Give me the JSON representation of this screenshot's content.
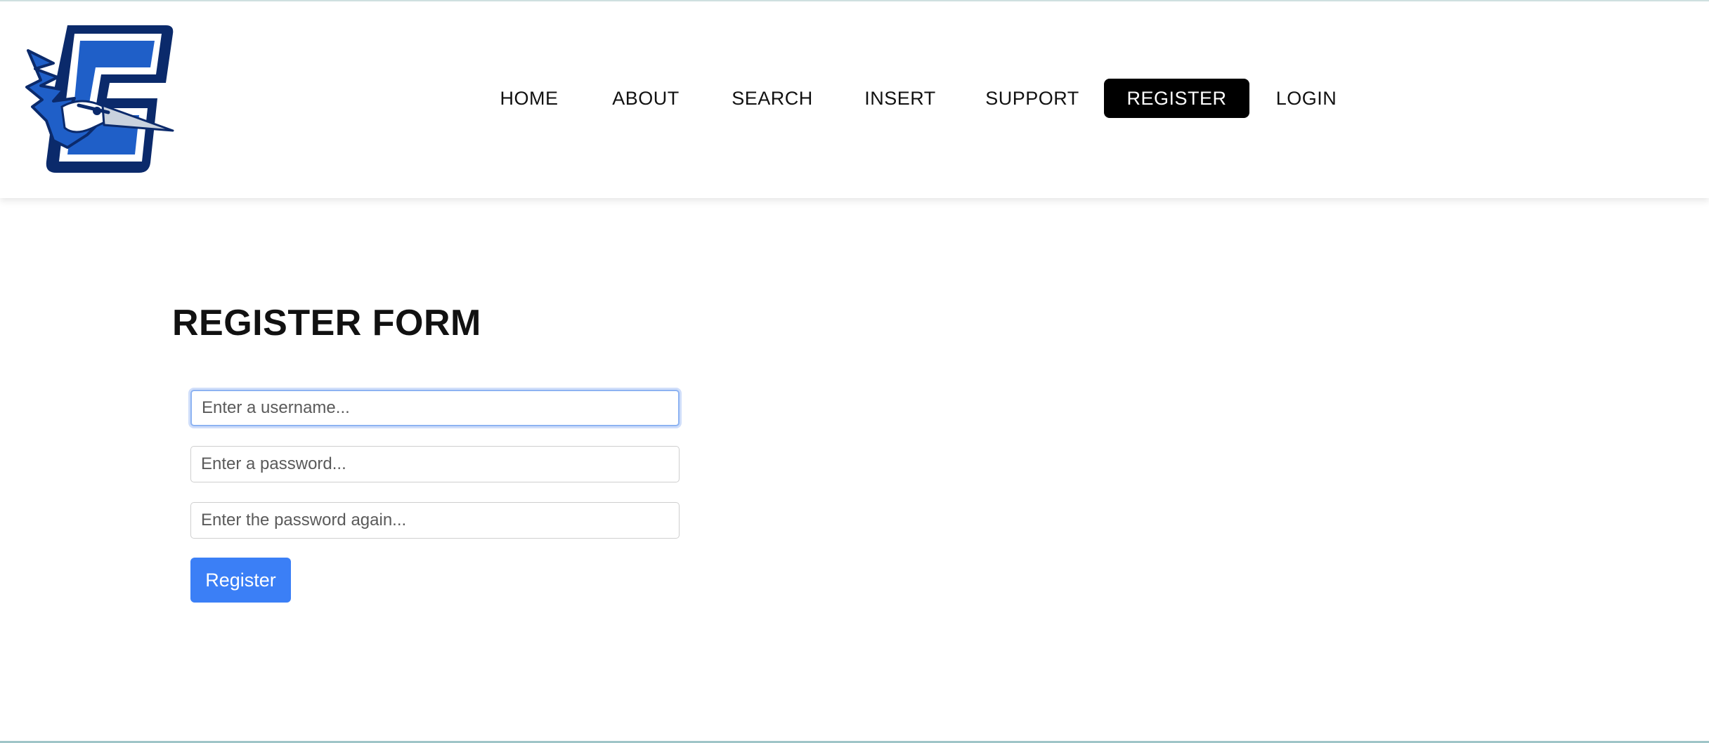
{
  "nav": {
    "items": [
      {
        "label": "HOME",
        "active": false
      },
      {
        "label": "ABOUT",
        "active": false
      },
      {
        "label": "SEARCH",
        "active": false
      },
      {
        "label": "INSERT",
        "active": false
      },
      {
        "label": "SUPPORT",
        "active": false
      },
      {
        "label": "REGISTER",
        "active": true
      },
      {
        "label": "LOGIN",
        "active": false
      }
    ]
  },
  "logo": {
    "icon": "bluejay-c-logo",
    "colors": {
      "navy": "#0b2a6b",
      "blue": "#1f5fc8",
      "light": "#ffffff"
    }
  },
  "form": {
    "title": "REGISTER FORM",
    "username_placeholder": "Enter a username...",
    "password_placeholder": "Enter a password...",
    "password_again_placeholder": "Enter the password again...",
    "submit_label": "Register"
  },
  "colors": {
    "active_nav_bg": "#000000",
    "button_bg": "#3b7ff6",
    "focus_ring": "#8db3f2"
  }
}
